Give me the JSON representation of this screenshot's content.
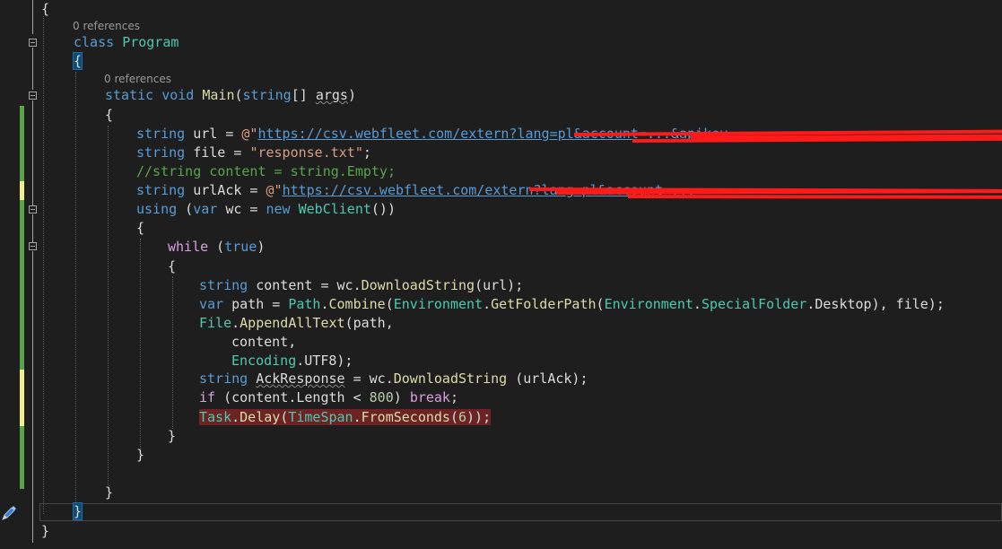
{
  "codelens": [
    "0 references",
    "0 references"
  ],
  "code": {
    "open_brace_ns": "{",
    "class_kw": "class",
    "class_name": "Program",
    "open_brace_class": "{",
    "static_kw": "static",
    "void_kw": "void",
    "main_name": "Main",
    "main_params_open": "(",
    "string_kw": "string",
    "main_params_rest": "[] ",
    "args": "args",
    "main_params_close": ")",
    "open_brace_main": "{",
    "line_url_var": " url = ",
    "line_url_at": "@\"",
    "line_url_value": "https://csv.webfleet.com/extern?lang=pl&account=...&apikey",
    "line_file_var": " file = ",
    "line_file_value": "\"response.txt\"",
    "line_file_end": ";",
    "comment_line": "//string content = string.Empty;",
    "line_ack_var": " urlAck = ",
    "line_ack_value": "https://csv.webfleet.com/extern?lang=pl&account=...",
    "using_kw": "using",
    "using_mid1": " (",
    "var_kw": "var",
    "using_mid2": " wc = ",
    "new_kw": "new",
    "webclient": "WebClient",
    "using_end": "())",
    "open_brace_using": "{",
    "while_kw": "while",
    "while_open": " (",
    "true_kw": "true",
    "while_close": ")",
    "open_brace_while": "{",
    "content_var": " content = wc.",
    "download_string": "DownloadString",
    "content_end": "(url);",
    "path_var": " path = ",
    "path_class": "Path",
    "dot": ".",
    "combine": "Combine",
    "paren_open": "(",
    "environment": "Environment",
    "get_folder_path": "GetFolderPath",
    "special_folder": "SpecialFolder",
    "path_end": ".Desktop), file);",
    "file_class": "File",
    "append_all_text": "AppendAllText",
    "append_args": "(path,",
    "content_arg": "content,",
    "encoding": "Encoding",
    "utf8_end": ".UTF8);",
    "ack_response": "AckResponse",
    "ack_mid": " = wc.",
    "ack_end": " (urlAck);",
    "if_kw": "if",
    "if_mid": " (content.Length < ",
    "num_800": "800",
    "if_close": ") ",
    "break_kw": "break",
    "semicolon": ";",
    "task_class": "Task",
    "delay": "Delay",
    "timespan": "TimeSpan",
    "from_seconds": "FromSeconds",
    "num_6": "6",
    "delay_end": "));",
    "close_brace_while": "}",
    "close_brace_using": "}",
    "close_brace_main": "}",
    "close_brace_class": "}",
    "close_brace_ns": "}"
  },
  "colors": {
    "background": "#1e1e1e",
    "keyword": "#569cd6",
    "control_keyword": "#d8a0df",
    "type": "#4ec9b0",
    "method": "#dcdcaa",
    "string": "#d69d85",
    "comment": "#57a64a",
    "number": "#b5cea8",
    "changed_saved": "#57a64a",
    "changed_unsaved": "#efef90",
    "breakpoint_highlight": "#6b2323",
    "redaction": "#ff1a1a"
  }
}
